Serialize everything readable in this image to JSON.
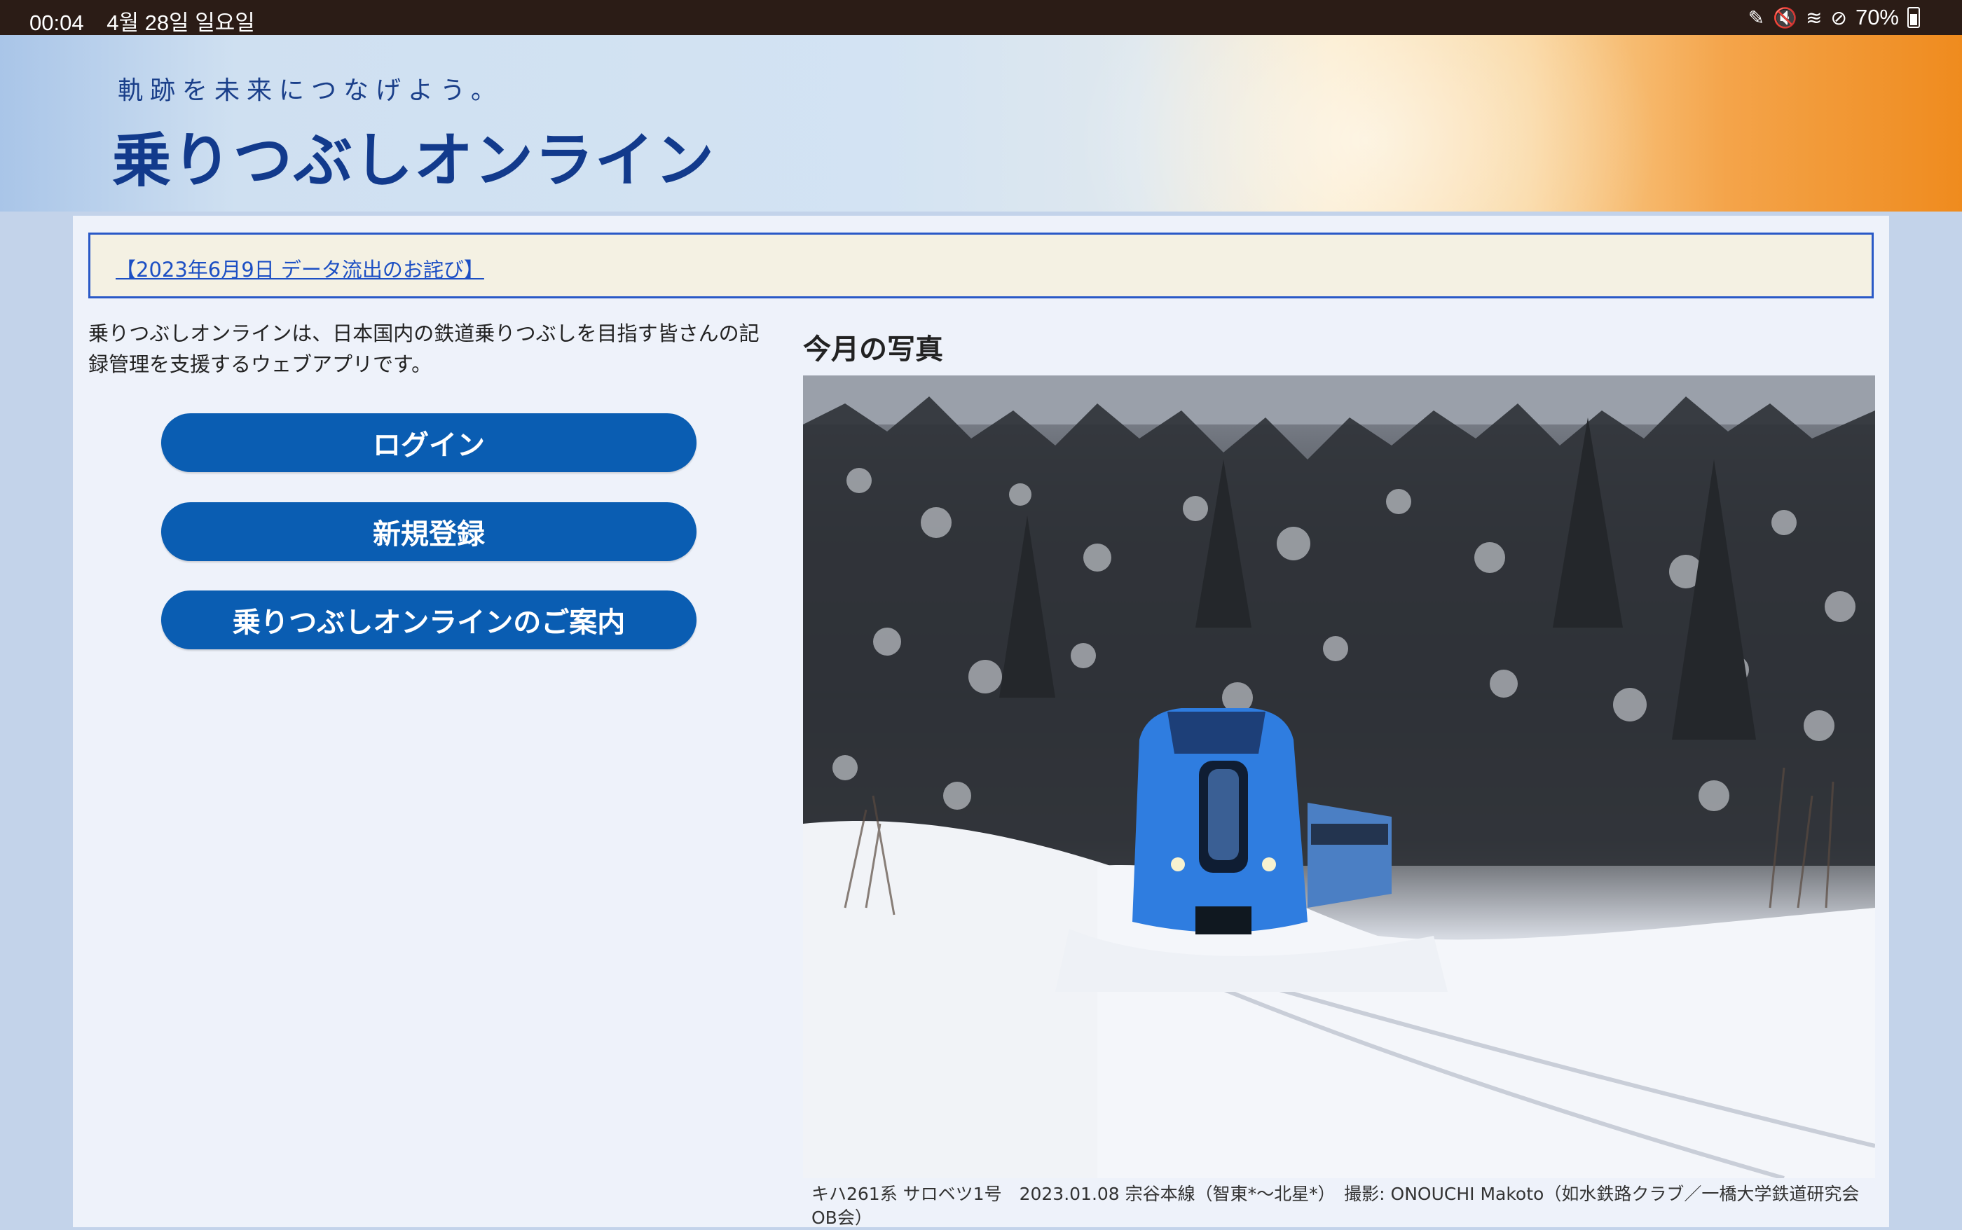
{
  "status_bar": {
    "time": "00:04",
    "date": "4월 28일 일요일",
    "battery": "70%",
    "icons": [
      "edit-icon",
      "mute-icon",
      "wifi-icon",
      "dnd-icon",
      "battery-icon"
    ]
  },
  "header": {
    "tagline": "軌跡を未来につなげよう。",
    "title": "乗りつぶしオンライン"
  },
  "notice": {
    "link_text": "【2023年6月9日 データ流出のお詫び】"
  },
  "intro": {
    "text": "乗りつぶしオンラインは、日本国内の鉄道乗りつぶしを目指す皆さんの記録管理を支援するウェブアプリです。"
  },
  "buttons": {
    "login": "ログイン",
    "register": "新規登録",
    "guide": "乗りつぶしオンラインのご案内"
  },
  "photo": {
    "heading": "今月の写真",
    "caption": "キハ261系 サロベツ1号　2023.01.08 宗谷本線（智東*～北星*）　撮影: ONOUCHI Makoto（如水鉄路クラブ／一橋大学鉄道研究会OB会）"
  },
  "colors": {
    "button_blue": "#0a5db2",
    "notice_border": "#2a59c7",
    "title_navy": "#123a8c",
    "train_blue": "#2f7de0"
  }
}
